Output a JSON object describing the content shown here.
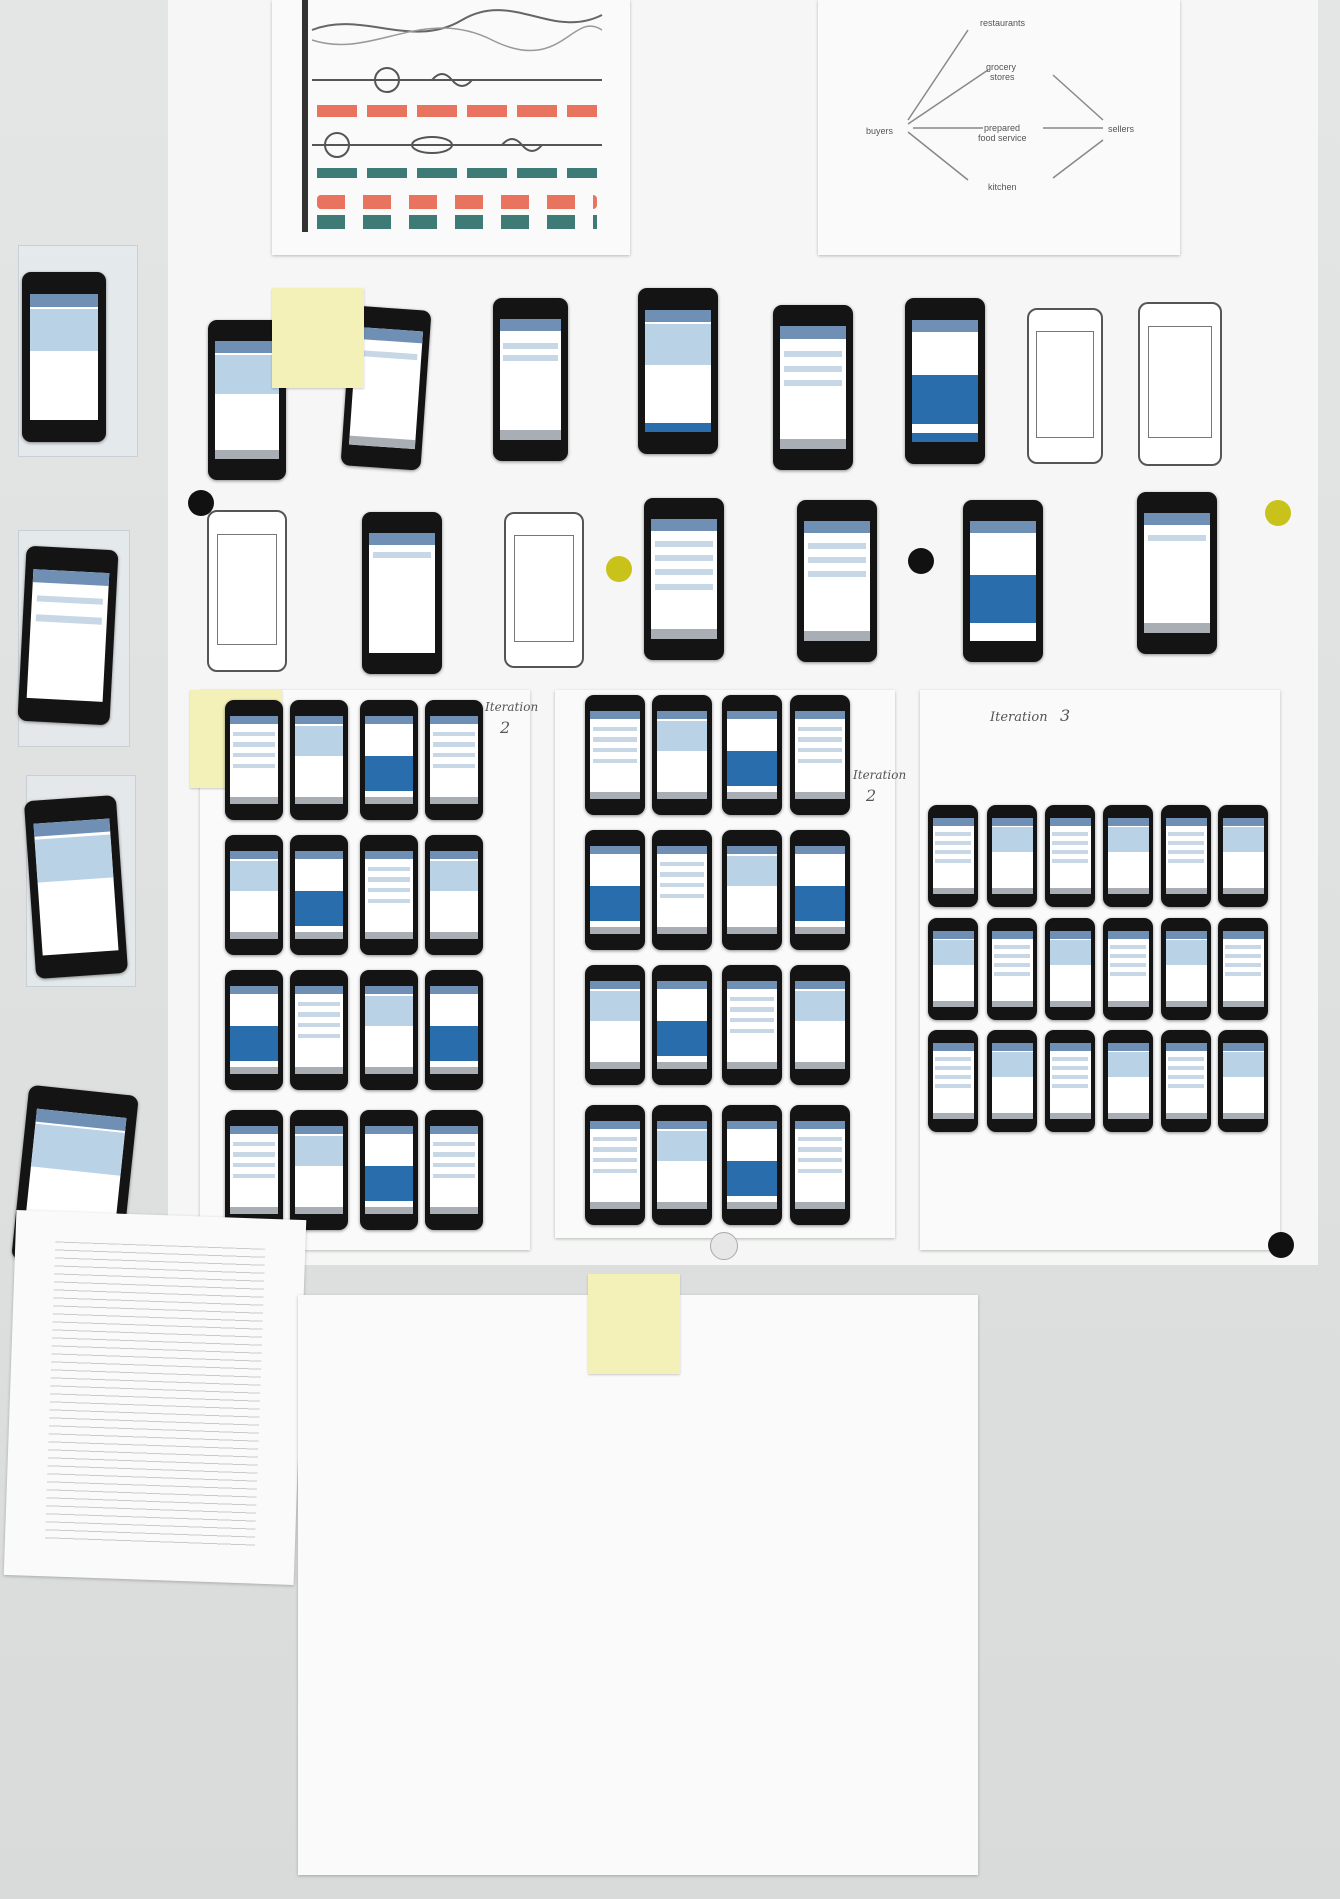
{
  "diagram": {
    "labels": [
      "restaurants",
      "grocery",
      "stores",
      "buyers",
      "prepared",
      "food service",
      "sellers",
      "kitchen"
    ]
  },
  "iteration_labels": [
    "Iteration",
    "2",
    "Iteration",
    "2",
    "Iteration",
    "3"
  ],
  "colors": {
    "wall": "#e1e3e3",
    "paper": "#fafafa",
    "phone_body": "#141414",
    "phone_screen_blue": "#b9d2e6",
    "accent_blue": "#2a6dad",
    "sticky_note": "#f4f1b8",
    "magnet_black": "#111111",
    "magnet_yellow": "#c9c21b",
    "timeline_red": "#e8735f",
    "timeline_teal": "#3e7b76"
  }
}
